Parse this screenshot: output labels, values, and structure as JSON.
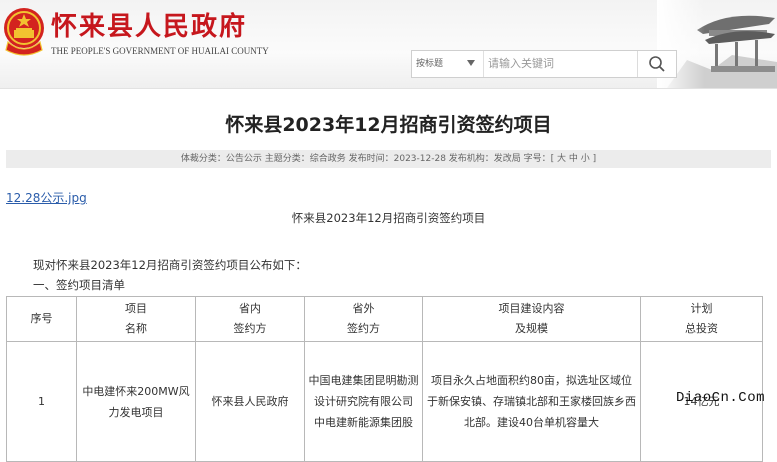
{
  "header": {
    "site_title": "怀来县人民政府",
    "site_subtitle": "THE PEOPLE'S GOVERNMENT OF HUAILAI COUNTY"
  },
  "search": {
    "scope": "按标题",
    "placeholder": "请输入关键词"
  },
  "article": {
    "title": "怀来县2023年12月招商引资签约项目",
    "meta": "体裁分类：公告公示  主题分类：综合政务  发布时间：2023-12-28  发布机构：发改局  字号：[ 大 中 小 ]",
    "attachment": "12.28公示.jpg",
    "subtitle": "怀来县2023年12月招商引资签约项目",
    "intro": "现对怀来县2023年12月招商引资签约项目公布如下：",
    "section": "一、签约项目清单"
  },
  "table": {
    "headers": [
      {
        "line1": "序号",
        "line2": ""
      },
      {
        "line1": "项目",
        "line2": "名称"
      },
      {
        "line1": "省内",
        "line2": "签约方"
      },
      {
        "line1": "省外",
        "line2": "签约方"
      },
      {
        "line1": "项目建设内容",
        "line2": "及规模"
      },
      {
        "line1": "计划",
        "line2": "总投资"
      }
    ],
    "rows": [
      {
        "no": "1",
        "name": "中电建怀来200MW风力发电项目",
        "in_province": "怀来县人民政府",
        "out_province": "中国电建集团昆明勘测设计研究院有限公司\n中电建新能源集团股",
        "content": "项目永久占地面积约80亩，拟选址区域位于新保安镇、存瑞镇北部和王家楼回族乡西北部。建设40台单机容量大",
        "investment": "14亿元"
      }
    ]
  },
  "watermark": "DiaoCn.Com",
  "colors": {
    "brand_red": "#c6171d",
    "link_blue": "#2a5caa"
  }
}
